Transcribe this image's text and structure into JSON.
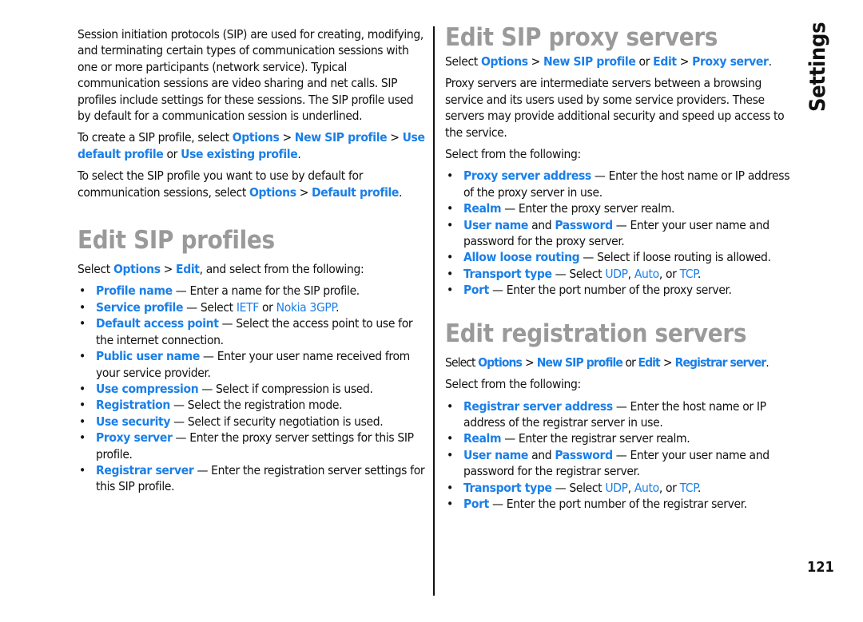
{
  "side_tab": "Settings",
  "page_number": "121",
  "left": {
    "intro": "Session initiation protocols (SIP) are used for creating, modifying, and terminating certain types of communication sessions with one or more participants (network service). Typical communication sessions are video sharing and net calls. SIP profiles include settings for these sessions. The SIP profile used by default for a communication session is underlined.",
    "create": {
      "pre": "To create a SIP profile, select ",
      "l1": "Options",
      "sep1": ">",
      "l2": "New SIP profile",
      "sep2": ">",
      "l3": "Use default profile",
      "mid": " or ",
      "l4": "Use existing profile",
      "end": "."
    },
    "default": {
      "pre": "To select the SIP profile you want to use by default for communication sessions, select ",
      "l1": "Options",
      "sep1": ">",
      "l2": "Default profile",
      "end": "."
    },
    "heading": "Edit SIP profiles",
    "select": {
      "pre": "Select ",
      "l1": "Options",
      "sep1": ">",
      "l2": "Edit",
      "post": ", and select from the following:"
    },
    "items": [
      {
        "term": "Profile name",
        "desc": " — Enter a name for the SIP profile."
      },
      {
        "term": "Service profile",
        "desc": " — Select ",
        "o1": "IETF",
        "mid": " or ",
        "o2": "Nokia 3GPP",
        "end": "."
      },
      {
        "term": "Default access point",
        "desc": " — Select the access point to use for the internet connection."
      },
      {
        "term": "Public user name",
        "desc": " — Enter your user name received from your service provider."
      },
      {
        "term": "Use compression",
        "desc": " — Select if compression is used."
      },
      {
        "term": "Registration",
        "desc": " — Select the registration mode."
      },
      {
        "term": "Use security",
        "desc": " — Select if security negotiation is used."
      },
      {
        "term": "Proxy server",
        "desc": " — Enter the proxy server settings for this SIP profile."
      },
      {
        "term": "Registrar server",
        "desc": " — Enter the registration server settings for this SIP profile."
      }
    ]
  },
  "right": {
    "proxy": {
      "heading": "Edit SIP proxy servers",
      "select": {
        "pre": "Select ",
        "l1": "Options",
        "sep1": ">",
        "l2": "New SIP profile",
        "mid": " or ",
        "l3": "Edit",
        "sep2": ">",
        "l4": "Proxy server",
        "end": "."
      },
      "desc": "Proxy servers are intermediate servers between a browsing service and its users used by some service providers. These servers may provide additional security and speed up access to the service.",
      "select_from": "Select from the following:",
      "items": [
        {
          "term": "Proxy server address",
          "desc": " — Enter the host name or IP address of the proxy server in use."
        },
        {
          "term": "Realm",
          "desc": " — Enter the proxy server realm."
        },
        {
          "term": "User name",
          "and": " and ",
          "term2": "Password",
          "desc": " — Enter your user name and password for the proxy server."
        },
        {
          "term": "Allow loose routing",
          "desc": " — Select if loose routing is allowed."
        },
        {
          "term": "Transport type",
          "desc": " — Select ",
          "o1": "UDP",
          "c1": ", ",
          "o2": "Auto",
          "c2": ", or ",
          "o3": "TCP",
          "end": "."
        },
        {
          "term": "Port",
          "desc": " — Enter the port number of the proxy server."
        }
      ]
    },
    "registrar": {
      "heading": "Edit registration servers",
      "select": {
        "pre": "Select ",
        "l1": "Options",
        "sep1": ">",
        "l2": "New SIP profile",
        "mid": " or ",
        "l3": "Edit",
        "sep2": ">",
        "l4": "Registrar server",
        "end": "."
      },
      "select_from": "Select from the following:",
      "items": [
        {
          "term": "Registrar server address",
          "desc": " — Enter the host name or IP address of the registrar server in use."
        },
        {
          "term": "Realm",
          "desc": " — Enter the registrar server realm."
        },
        {
          "term": "User name",
          "and": " and ",
          "term2": "Password",
          "desc": " — Enter your user name and password for the registrar server."
        },
        {
          "term": "Transport type",
          "desc": " — Select ",
          "o1": "UDP",
          "c1": ", ",
          "o2": "Auto",
          "c2": ", or ",
          "o3": "TCP",
          "end": "."
        },
        {
          "term": "Port",
          "desc": " — Enter the port number of the registrar server."
        }
      ]
    }
  }
}
